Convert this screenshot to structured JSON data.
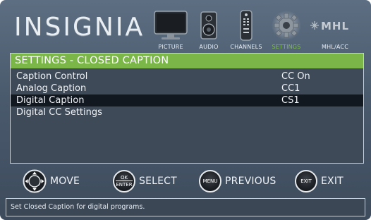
{
  "header": {
    "brand": "INSIGNIA",
    "nav": [
      {
        "label": "PICTURE",
        "icon": "picture-icon",
        "active": false
      },
      {
        "label": "AUDIO",
        "icon": "audio-icon",
        "active": false
      },
      {
        "label": "CHANNELS",
        "icon": "channels-icon",
        "active": false
      },
      {
        "label": "SETTINGS",
        "icon": "settings-icon",
        "active": true
      },
      {
        "label": "MHL/ACC",
        "icon": "mhl-icon",
        "active": false
      }
    ],
    "mhl_logo": "MHL"
  },
  "panel": {
    "title": "SETTINGS - CLOSED CAPTION",
    "rows": [
      {
        "name": "Caption Control",
        "value": "CC On",
        "selected": false
      },
      {
        "name": "Analog Caption",
        "value": "CC1",
        "selected": false
      },
      {
        "name": "Digital Caption",
        "value": "CS1",
        "selected": true
      },
      {
        "name": "Digital CC Settings",
        "value": "",
        "selected": false
      }
    ]
  },
  "buttons": {
    "move": {
      "label": "MOVE",
      "icon": "dpad-icon"
    },
    "select": {
      "label": "SELECT",
      "icon_text_top": "OK",
      "icon_text_bottom": "ENTER"
    },
    "previous": {
      "label": "PREVIOUS",
      "icon_text": "MENU"
    },
    "exit": {
      "label": "EXIT",
      "icon_text": "EXIT"
    }
  },
  "status": {
    "text": "Set Closed Caption for digital programs."
  },
  "colors": {
    "accent": "#7ab648",
    "selected_row": "#121820",
    "active_nav": "#7dc242"
  }
}
